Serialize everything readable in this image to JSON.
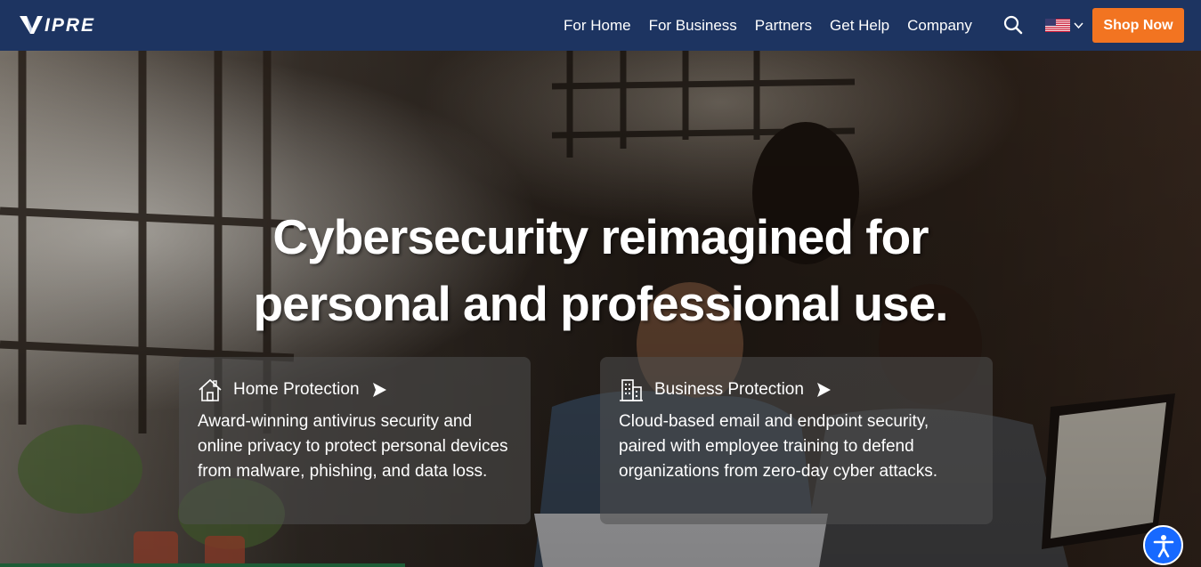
{
  "header": {
    "logo_text": "VIPRE",
    "nav": [
      "For Home",
      "For Business",
      "Partners",
      "Get Help",
      "Company"
    ],
    "shop_label": "Shop Now",
    "search_icon": "search-icon",
    "language_icon": "us-flag-icon"
  },
  "hero": {
    "title_line1": "Cybersecurity reimagined for",
    "title_line2": "personal and professional use."
  },
  "cards": [
    {
      "icon": "house-icon",
      "title": "Home Protection",
      "text": "Award-winning antivirus security and online privacy to protect personal devices from malware, phishing, and data loss."
    },
    {
      "icon": "building-icon",
      "title": "Business Protection",
      "text": "Cloud-based email and endpoint security, paired with employee training to defend organizations from zero-day cyber attacks."
    }
  ],
  "colors": {
    "header_bg": "#1d3461",
    "accent": "#f27421",
    "accessibility": "#1769ff"
  },
  "accessibility_icon": "accessibility-icon"
}
